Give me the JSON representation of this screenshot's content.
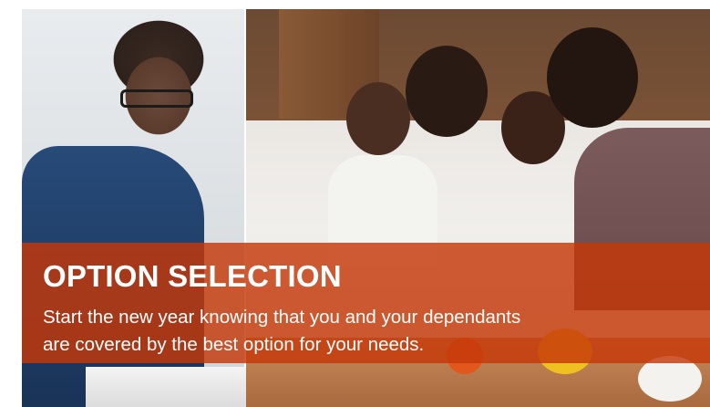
{
  "banner": {
    "title": "OPTION SELECTION",
    "body_line_1": "Start the new year knowing that you and your dependants",
    "body_line_2": "are covered by the best option for your needs.",
    "overlay_color": "#c43808",
    "text_color": "#ffffff"
  },
  "images": {
    "left_photo": "photo-woman-with-glasses",
    "right_photo": "photo-family-cooking"
  }
}
